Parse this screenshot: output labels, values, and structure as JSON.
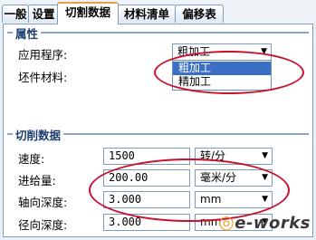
{
  "tabs": [
    {
      "label": "一般",
      "active": false
    },
    {
      "label": "设置",
      "active": false
    },
    {
      "label": "切割数据",
      "active": true
    },
    {
      "label": "材料清单",
      "active": false
    },
    {
      "label": "偏移表",
      "active": false
    }
  ],
  "properties": {
    "title": "属性",
    "application_label": "应用程序:",
    "application_value": "粗加工",
    "application_options": [
      "粗加工",
      "精加工"
    ],
    "application_selected_index": 0,
    "stock_material_label": "坯件材料:"
  },
  "cutting_data": {
    "title": "切削数据",
    "speed_label": "速度:",
    "speed_value": "1500",
    "speed_unit": "转/分",
    "feed_label": "进给量:",
    "feed_value": "200.00",
    "feed_unit": "毫米/分",
    "axial_label": "轴向深度:",
    "axial_value": "3.000",
    "axial_unit": "mm",
    "radial_label": "径向深度:",
    "radial_value": "3.000",
    "radial_unit": "mm"
  },
  "watermark": {
    "text": "e-works"
  },
  "colors": {
    "highlight_ellipse": "#c8102e",
    "selection": "#3a6fc4"
  }
}
